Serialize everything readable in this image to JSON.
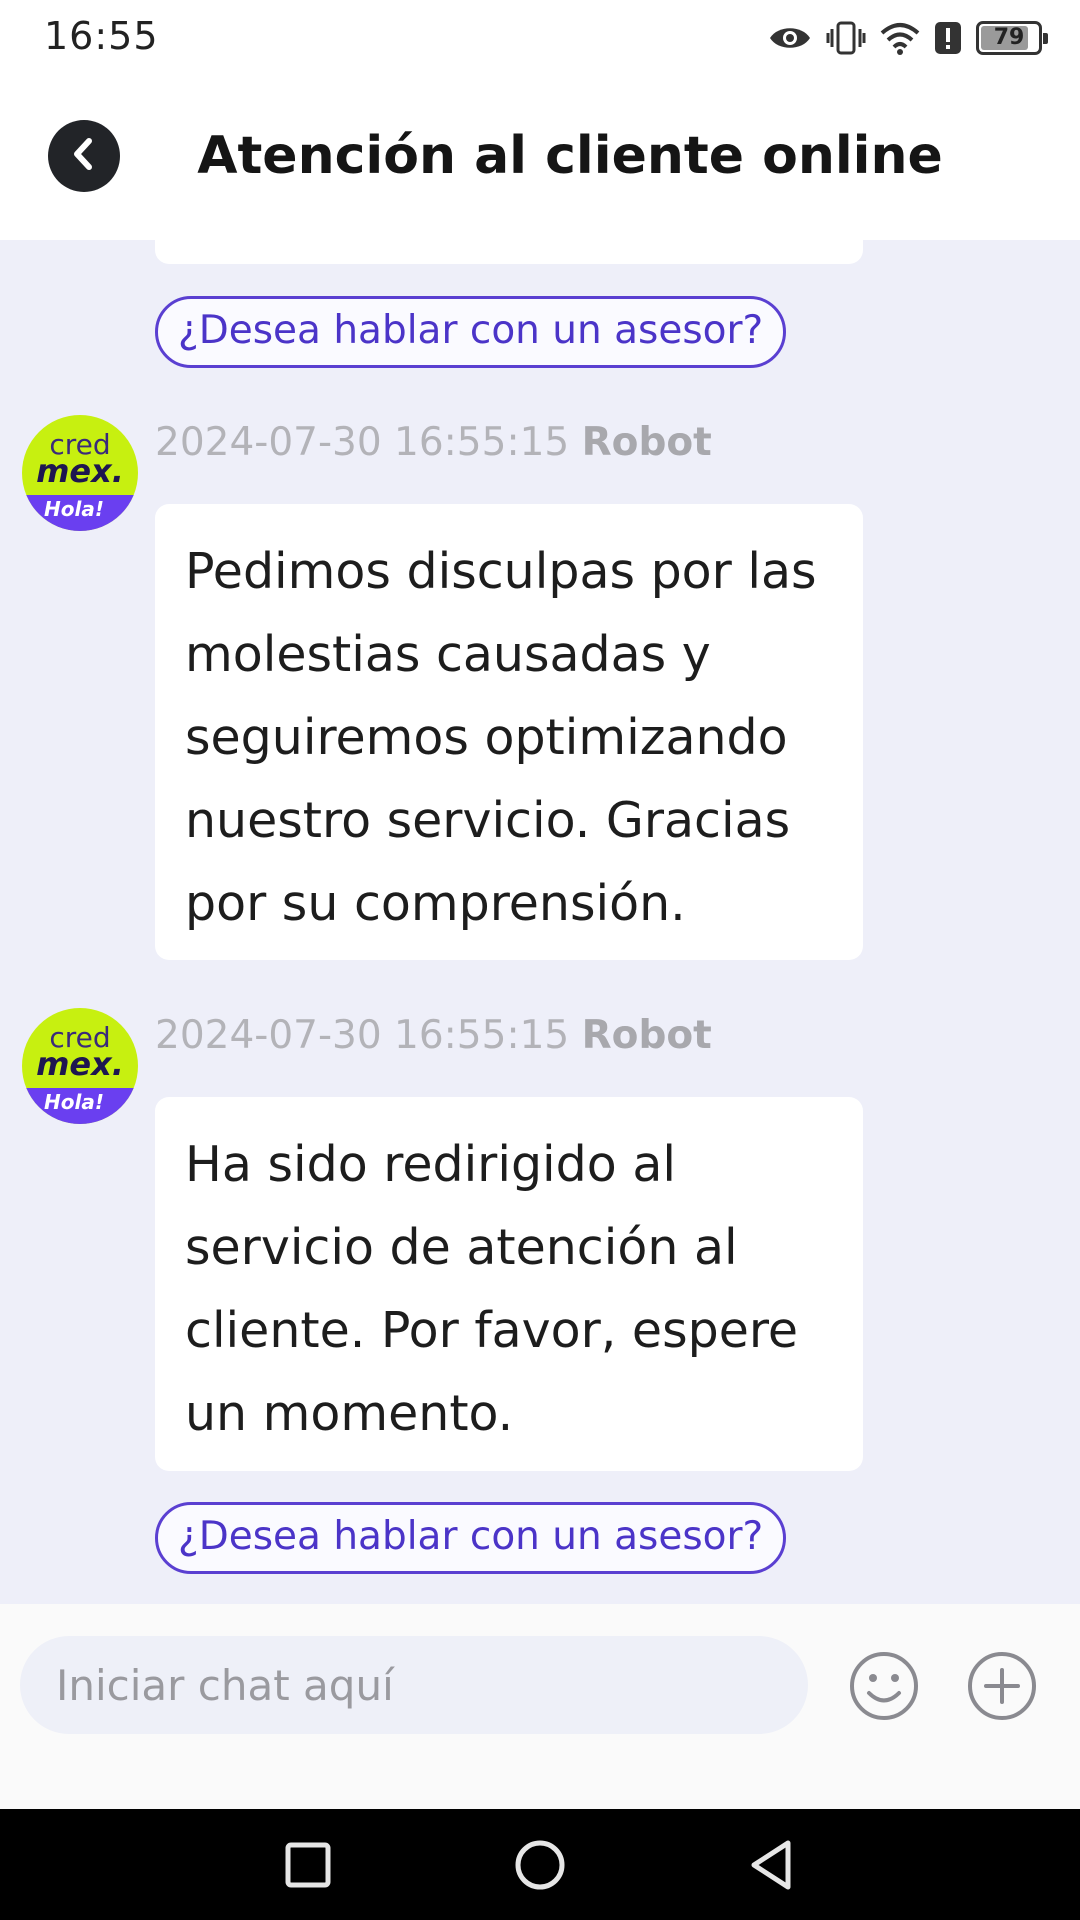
{
  "status_bar": {
    "time": "16:55",
    "battery_level": "79",
    "icons": [
      "eye-icon",
      "vibrate-icon",
      "wifi-icon",
      "alert-icon",
      "battery-icon"
    ]
  },
  "header": {
    "title": "Atención al cliente online",
    "back_icon": "chevron-left-icon"
  },
  "chat": {
    "suggestion_label": "¿Desea hablar con un asesor?",
    "avatar_brand": {
      "line1": "cred",
      "line2": "mex.",
      "tagline": "Hola!"
    },
    "messages": [
      {
        "timestamp": "2024-07-30 16:55:15",
        "sender": "Robot",
        "text": "Pedimos disculpas por las molestias causadas y seguiremos optimizando nuestro servicio. Gracias por su comprensión."
      },
      {
        "timestamp": "2024-07-30 16:55:15",
        "sender": "Robot",
        "text": "Ha sido redirigido al servicio de atención al cliente. Por favor, espere un momento."
      }
    ]
  },
  "input_bar": {
    "placeholder": "Iniciar chat aquí",
    "emoji_icon": "smiley-icon",
    "attach_icon": "plus-circle-icon"
  },
  "nav_bar": {
    "icons": [
      "recents-square-icon",
      "home-circle-icon",
      "back-triangle-icon"
    ]
  },
  "colors": {
    "accent": "#5a3fd1",
    "chat_background": "#eeeff9",
    "avatar_green": "#c7f010",
    "avatar_purple": "#6a3ff0"
  }
}
